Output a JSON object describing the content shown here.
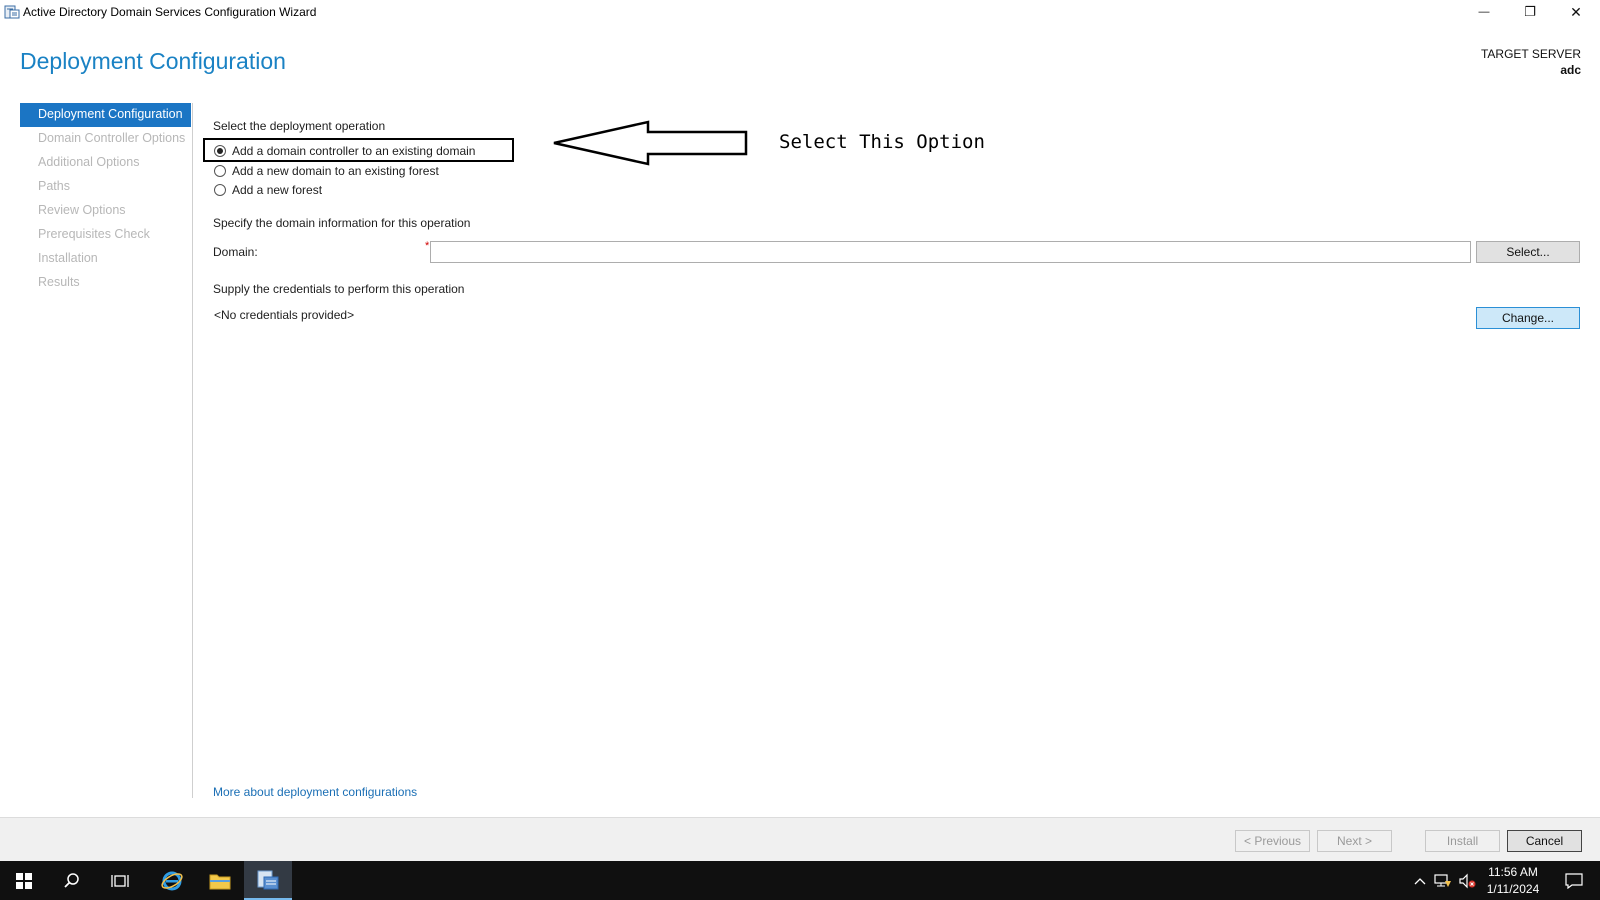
{
  "window": {
    "title": "Active Directory Domain Services Configuration Wizard",
    "minimize_glyph": "—",
    "restore_glyph": "❐",
    "close_glyph": "✕"
  },
  "header": {
    "page_title": "Deployment Configuration",
    "target_server_label": "TARGET SERVER",
    "target_server_name": "adc"
  },
  "nav": {
    "items": [
      {
        "label": "Deployment Configuration",
        "active": true
      },
      {
        "label": "Domain Controller Options",
        "active": false
      },
      {
        "label": "Additional Options",
        "active": false
      },
      {
        "label": "Paths",
        "active": false
      },
      {
        "label": "Review Options",
        "active": false
      },
      {
        "label": "Prerequisites Check",
        "active": false
      },
      {
        "label": "Installation",
        "active": false
      },
      {
        "label": "Results",
        "active": false
      }
    ]
  },
  "deployment": {
    "heading": "Select the deployment operation",
    "options": [
      {
        "label": "Add a domain controller to an existing domain",
        "checked": true
      },
      {
        "label": "Add a new domain to an existing forest",
        "checked": false
      },
      {
        "label": "Add a new forest",
        "checked": false
      }
    ]
  },
  "annotation": {
    "text": "Select This Option"
  },
  "domain_info": {
    "heading": "Specify the domain information for this operation",
    "domain_label": "Domain:",
    "required_marker": "*",
    "domain_value": "",
    "select_button": "Select..."
  },
  "credentials": {
    "heading": "Supply the credentials to perform this operation",
    "status": "<No credentials provided>",
    "change_button": "Change..."
  },
  "links": {
    "more_about": "More about deployment configurations"
  },
  "footer": {
    "previous": "< Previous",
    "next": "Next >",
    "install": "Install",
    "cancel": "Cancel"
  },
  "taskbar": {
    "time": "11:56 AM",
    "date": "1/11/2024",
    "icons": [
      "windows-start-icon",
      "search-icon",
      "task-view-icon",
      "internet-explorer-icon",
      "file-explorer-icon",
      "server-manager-icon"
    ]
  }
}
